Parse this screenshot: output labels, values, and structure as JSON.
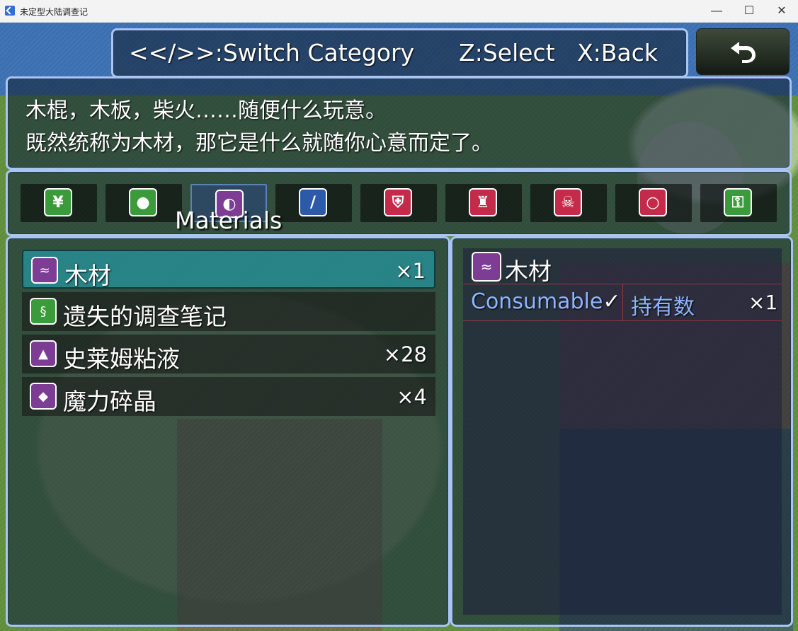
{
  "window": {
    "title": "未定型大陆调查记",
    "minimize": "—",
    "maximize": "☐",
    "close": "✕"
  },
  "help": {
    "text": "<</>>:Switch Category      Z:Select   X:Back"
  },
  "description": {
    "line1": "木棍，木板，柴火……随便什么玩意。",
    "line2": "既然统称为木材，那它是什么就随你心意而定了。"
  },
  "categories": {
    "selected_label": "Materials",
    "tabs": [
      {
        "icon": "bag-icon",
        "glyph": "¥",
        "color": "#3a9b3a"
      },
      {
        "icon": "bomb-icon",
        "glyph": "●",
        "color": "#3a9b3a"
      },
      {
        "icon": "orb-icon",
        "glyph": "◐",
        "color": "#7d3d95"
      },
      {
        "icon": "sword-icon",
        "glyph": "/",
        "color": "#2d5aa8"
      },
      {
        "icon": "shield-icon",
        "glyph": "⛨",
        "color": "#c42a4a"
      },
      {
        "icon": "helmet-icon",
        "glyph": "♜",
        "color": "#c42a4a"
      },
      {
        "icon": "skull-icon",
        "glyph": "☠",
        "color": "#c42a4a"
      },
      {
        "icon": "ring-icon",
        "glyph": "○",
        "color": "#c42a4a"
      },
      {
        "icon": "key-icon",
        "glyph": "⚿",
        "color": "#3a9b3a"
      }
    ]
  },
  "items": [
    {
      "name": "木材",
      "qty": "×1",
      "icon": "log-icon",
      "glyph": "≈",
      "color": "#7d3d95"
    },
    {
      "name": "遗失的调查笔记",
      "qty": "",
      "icon": "scroll-icon",
      "glyph": "§",
      "color": "#3a9b3a"
    },
    {
      "name": "史莱姆粘液",
      "qty": "×28",
      "icon": "slime-icon",
      "glyph": "▲",
      "color": "#7d3d95"
    },
    {
      "name": "魔力碎晶",
      "qty": "×4",
      "icon": "crystal-icon",
      "glyph": "◆",
      "color": "#7d3d95"
    }
  ],
  "detail": {
    "name": "木材",
    "icon": "log-icon",
    "glyph": "≈",
    "consumable_label": "Consumable",
    "consumable_check": "✓",
    "held_label": "持有数",
    "held_qty": "×1"
  }
}
